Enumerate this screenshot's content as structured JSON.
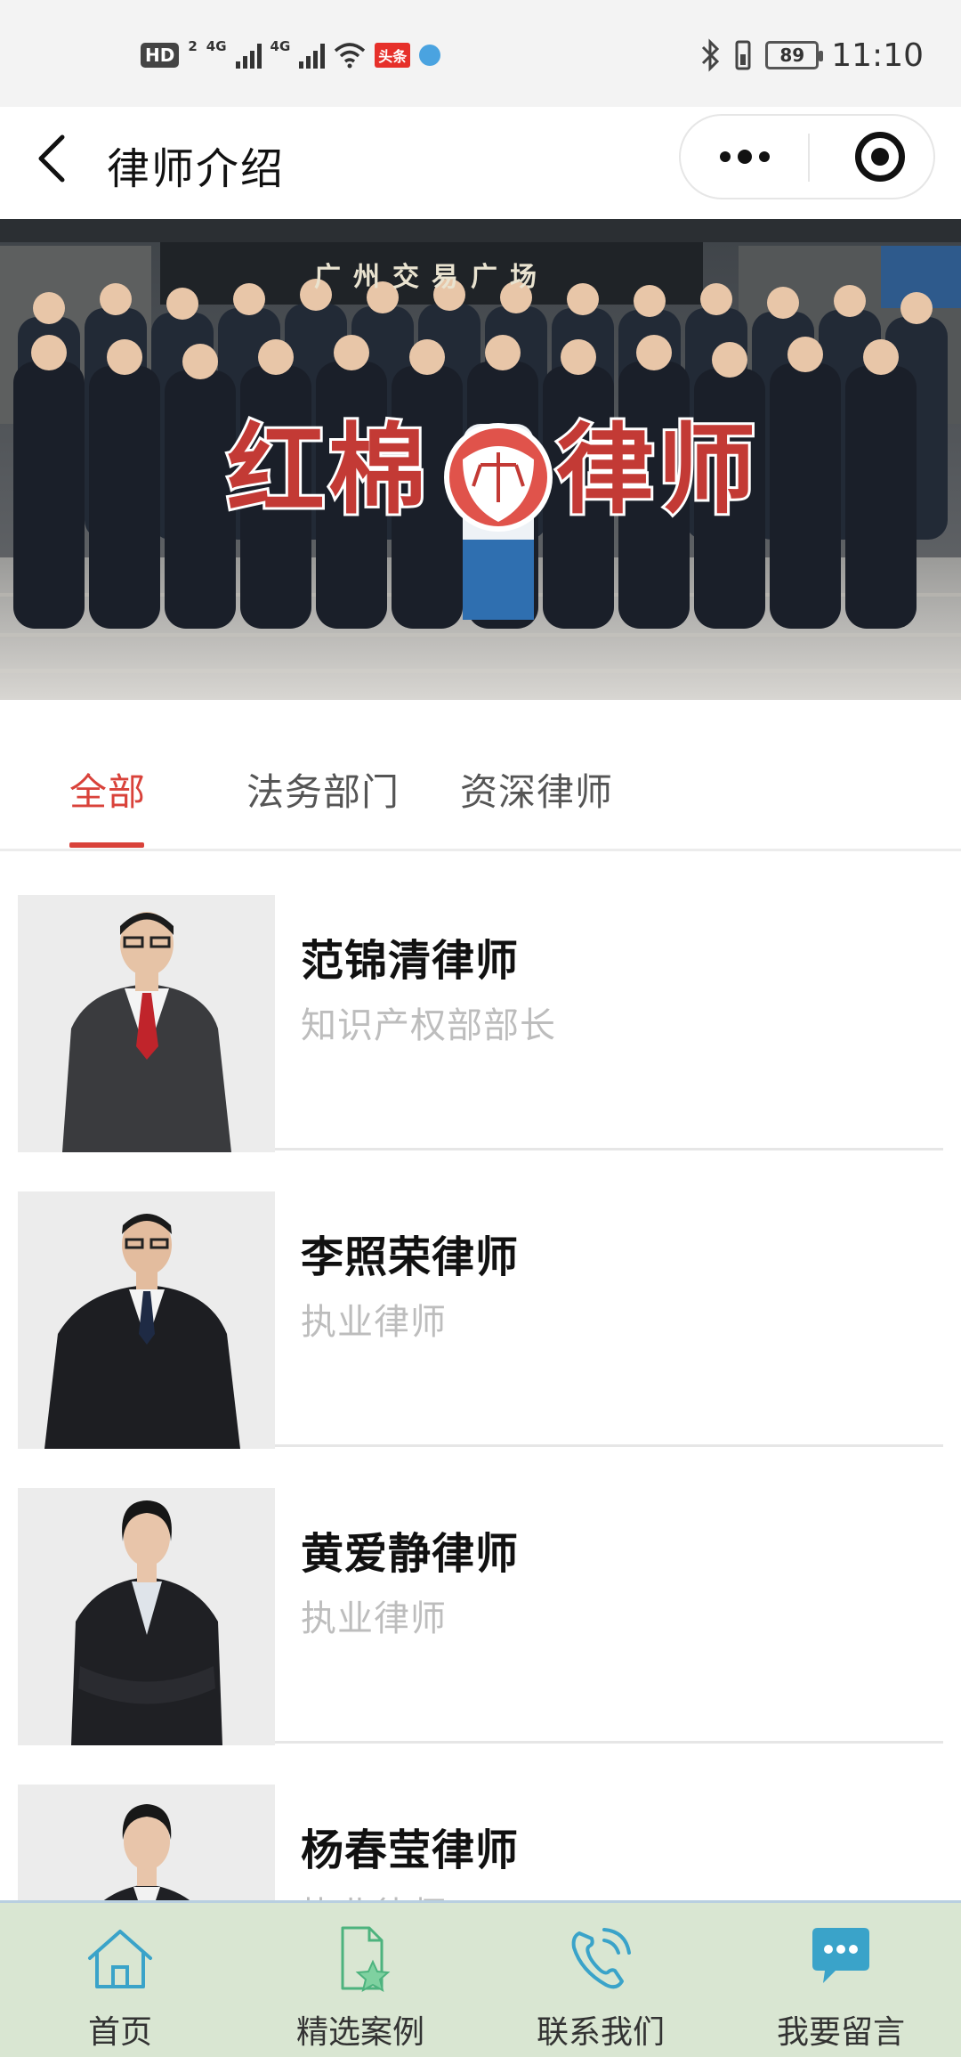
{
  "status_bar": {
    "hd": "HD",
    "hd_sub": "2",
    "net1": "4G",
    "net2": "4G",
    "toutiao": "头条",
    "battery": "89",
    "time": "11:10"
  },
  "header": {
    "title": "律师介绍"
  },
  "banner": {
    "sign_text": "广州交易广场",
    "logo_text_left": "红棉",
    "logo_text_right": "律师"
  },
  "tabs": [
    {
      "label": "全部",
      "active": true
    },
    {
      "label": "法务部门",
      "active": false
    },
    {
      "label": "资深律师",
      "active": false
    }
  ],
  "lawyers": [
    {
      "name": "范锦清律师",
      "role": "知识产权部部长"
    },
    {
      "name": "李照荣律师",
      "role": "执业律师"
    },
    {
      "name": "黄爱静律师",
      "role": "执业律师"
    },
    {
      "name": "杨春莹律师",
      "role": "执业律师"
    }
  ],
  "bottom_nav": [
    {
      "label": "首页",
      "icon": "home-icon"
    },
    {
      "label": "精选案例",
      "icon": "document-star-icon"
    },
    {
      "label": "联系我们",
      "icon": "phone-icon"
    },
    {
      "label": "我要留言",
      "icon": "chat-bubble-icon"
    }
  ],
  "colors": {
    "accent": "#d9423a",
    "nav_bg": "#d9e6d2",
    "nav_icon": "#3aa3c9",
    "role_text": "#bdbdbd"
  }
}
